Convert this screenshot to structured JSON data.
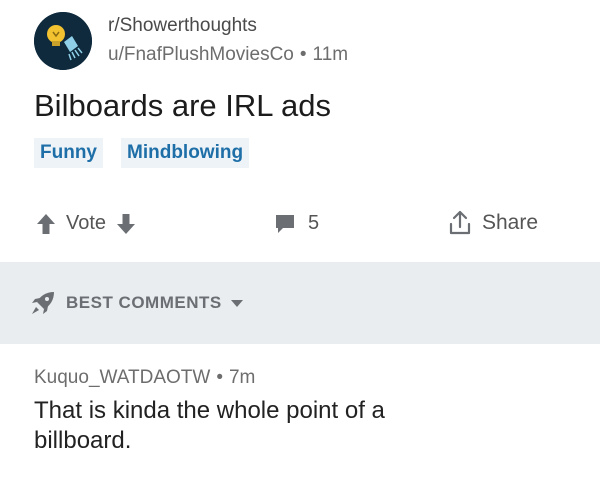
{
  "post": {
    "subreddit": "r/Showerthoughts",
    "author": "u/FnafPlushMoviesCo",
    "separator": "•",
    "age": "11m",
    "title": "Bilboards are IRL ads",
    "flairs": [
      "Funny",
      "Mindblowing"
    ]
  },
  "actions": {
    "vote_label": "Vote",
    "comment_count": "5",
    "share_label": "Share"
  },
  "sort": {
    "label": "BEST COMMENTS"
  },
  "comment": {
    "author": "Kuquo_WATDAOTW",
    "separator": "•",
    "age": "7m",
    "body": "That is kinda the whole point of a billboard."
  },
  "colors": {
    "accent": "#1e6fa8",
    "flair_bg": "#eef3f7",
    "icon_gray": "#6b6f73",
    "sortbar_bg": "#e9edf0",
    "avatar_bg": "#0e2a3c"
  },
  "icons": {
    "avatar": "shower-lightbulb-icon",
    "upvote": "arrow-up-icon",
    "downvote": "arrow-down-icon",
    "comments": "comment-bubble-icon",
    "share": "share-icon",
    "sort": "rocket-icon",
    "dropdown": "caret-down-icon"
  }
}
